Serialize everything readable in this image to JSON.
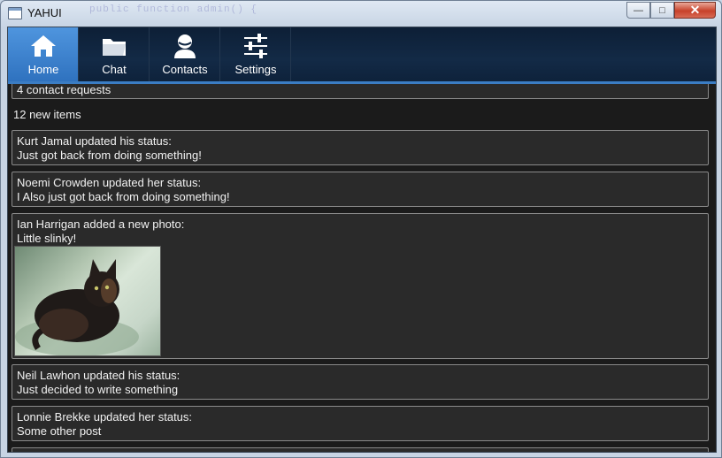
{
  "window": {
    "title": "YAHUI",
    "ghost_text": "public function admin() {",
    "controls": {
      "minimize": "—",
      "maximize": "□",
      "close": "✕"
    }
  },
  "nav": {
    "items": [
      {
        "label": "Home",
        "icon": "home-icon"
      },
      {
        "label": "Chat",
        "icon": "folder-icon"
      },
      {
        "label": "Contacts",
        "icon": "user-icon"
      },
      {
        "label": "Settings",
        "icon": "sliders-icon"
      }
    ],
    "active": "Home",
    "accent": "#3b7dc4"
  },
  "feed": {
    "contact_requests": "4 contact requests",
    "new_items": "12 new items",
    "posts": [
      {
        "header": "Kurt Jamal updated his status:",
        "body": "Just got back from doing something!"
      },
      {
        "header": "Noemi Crowden updated her status:",
        "body": "I Also just got back from doing something!"
      },
      {
        "header": "Ian Harrigan added a new photo:",
        "body": "Little slinky!",
        "has_photo": true
      },
      {
        "header": "Neil Lawhon updated his status:",
        "body": "Just decided to write something"
      },
      {
        "header": "Lonnie Brekke updated her status:",
        "body": "Some other post"
      }
    ]
  }
}
